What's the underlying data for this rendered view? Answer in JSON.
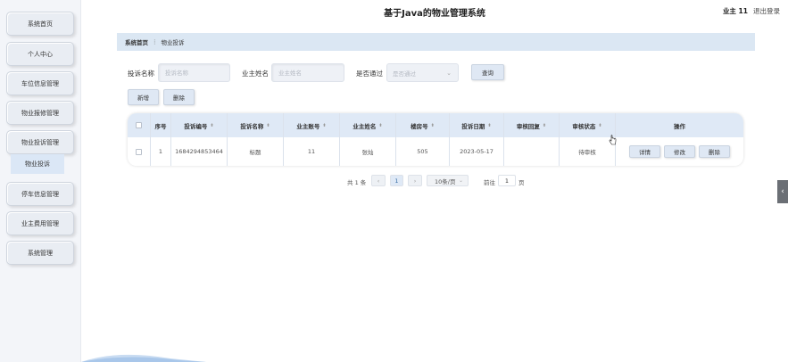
{
  "header": {
    "title": "基于Java的物业管理系统",
    "user": "业主 11",
    "logout": "退出登录"
  },
  "sidebar": {
    "items": [
      {
        "label": "系统首页"
      },
      {
        "label": "个人中心"
      },
      {
        "label": "车位信息管理"
      },
      {
        "label": "物业报修管理"
      },
      {
        "label": "物业投诉管理"
      },
      {
        "label": "停车信息管理"
      },
      {
        "label": "业主费用管理"
      },
      {
        "label": "系统管理"
      }
    ],
    "active_sub": "物业投诉"
  },
  "breadcrumb": {
    "home": "系统首页",
    "separator": "⋮",
    "current": "物业投诉"
  },
  "search": {
    "complaint_name_label": "投诉名称",
    "complaint_name_placeholder": "投诉名称",
    "owner_name_label": "业主姓名",
    "owner_name_placeholder": "业主姓名",
    "approved_label": "是否通过",
    "approved_placeholder": "是否通过",
    "query_button": "查询"
  },
  "actions": {
    "add": "新增",
    "delete": "删除"
  },
  "table": {
    "columns": [
      "序号",
      "投诉编号",
      "投诉名称",
      "业主账号",
      "业主姓名",
      "楼房号",
      "投诉日期",
      "审核回复",
      "审核状态",
      "操作"
    ],
    "sortable": [
      false,
      true,
      true,
      true,
      true,
      true,
      true,
      true,
      true,
      false
    ],
    "rows": [
      {
        "index": "1",
        "complaint_no": "1684294853464",
        "complaint_name": "标题",
        "owner_account": "11",
        "owner_name": "张灿",
        "room_no": "505",
        "date": "2023-05-17",
        "reply": "",
        "status": "待审核"
      }
    ],
    "row_actions": {
      "detail": "详情",
      "edit": "修改",
      "delete": "删除"
    }
  },
  "pagination": {
    "total": "共 1 条",
    "prev": "‹",
    "page": "1",
    "next": "›",
    "page_size": "10条/页",
    "goto_prefix": "前往",
    "goto_value": "1",
    "goto_suffix": "页"
  },
  "colors": {
    "header_row": "#dfe9f6",
    "button": "#dfe8f4",
    "breadcrumb": "#dbe7f3",
    "sidebar": "#f3f5f9"
  }
}
